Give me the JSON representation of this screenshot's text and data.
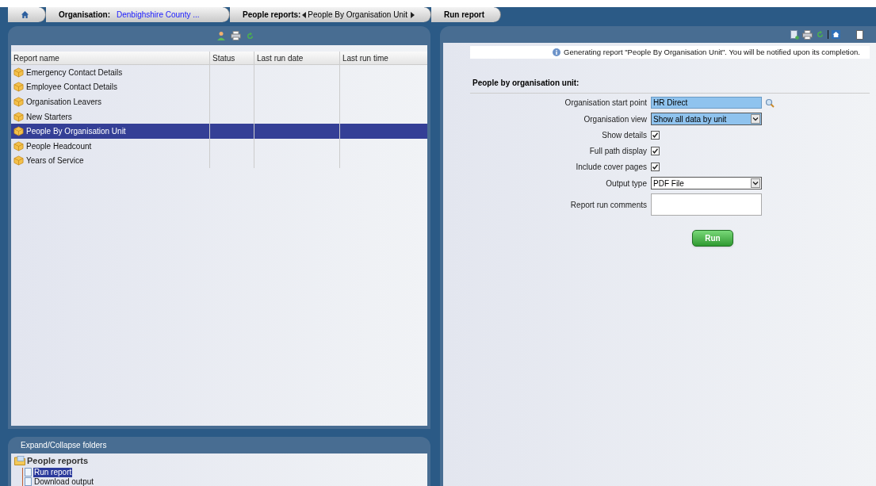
{
  "breadcrumbs": [
    {
      "kind": "home"
    },
    {
      "kind": "link",
      "label": "Organisation:",
      "value": "Denbighshire County ..."
    },
    {
      "kind": "picker",
      "label": "People reports:",
      "value": "People By Organisation Unit"
    },
    {
      "kind": "plain",
      "label": "Run report"
    }
  ],
  "report_table": {
    "columns": [
      "Report name",
      "Status",
      "Last run date",
      "Last run time"
    ],
    "rows": [
      {
        "name": "Emergency Contact Details",
        "selected": false
      },
      {
        "name": "Employee Contact Details",
        "selected": false
      },
      {
        "name": "Organisation Leavers",
        "selected": false
      },
      {
        "name": "New Starters",
        "selected": false
      },
      {
        "name": "People By Organisation Unit",
        "selected": true
      },
      {
        "name": "People Headcount",
        "selected": false
      },
      {
        "name": "Years of Service",
        "selected": false
      }
    ]
  },
  "folders_panel": {
    "title": "Expand/Collapse folders",
    "tree": [
      {
        "label": "People reports",
        "children": [
          {
            "label": "Run report",
            "selected": true
          },
          {
            "label": "Download output",
            "selected": false
          }
        ]
      }
    ]
  },
  "notice": "Generating report \"People By Organisation Unit\". You will be notified upon its completion.",
  "form": {
    "title": "People by organisation unit:",
    "fields": [
      {
        "kind": "lookup",
        "label": "Organisation start point",
        "value": "HR Direct"
      },
      {
        "kind": "select",
        "label": "Organisation view",
        "value": "Show all data by unit",
        "highlighted": true
      },
      {
        "kind": "checkbox",
        "label": "Show details",
        "checked": true
      },
      {
        "kind": "checkbox",
        "label": "Full path display",
        "checked": true
      },
      {
        "kind": "checkbox",
        "label": "Include cover pages",
        "checked": true
      },
      {
        "kind": "select",
        "label": "Output type",
        "value": "PDF File",
        "highlighted": false
      },
      {
        "kind": "textarea",
        "label": "Report run comments"
      }
    ],
    "run_button": "Run"
  }
}
